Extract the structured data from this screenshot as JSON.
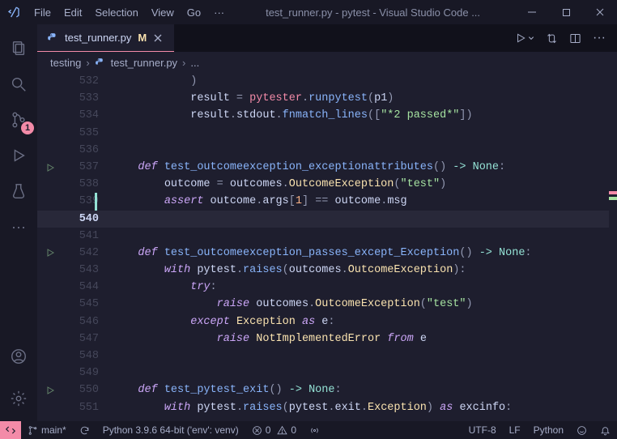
{
  "titlebar": {
    "menuItems": [
      "File",
      "Edit",
      "Selection",
      "View",
      "Go"
    ],
    "menuOverflow": "···",
    "title": "test_runner.py - pytest - Visual Studio Code ..."
  },
  "activitybar": {
    "sourceControlBadge": "1"
  },
  "tab": {
    "name": "test_runner.py",
    "modified": "M"
  },
  "breadcrumbs": {
    "folder": "testing",
    "file": "test_runner.py",
    "trail": "..."
  },
  "code": {
    "startLine": 532,
    "currentLine": 540,
    "editBarLine": 539,
    "runIconLines": [
      537,
      542,
      550
    ],
    "lines": [
      {
        "n": 532,
        "i": 2,
        "t": [
          {
            "c": "p",
            "v": ")"
          }
        ]
      },
      {
        "n": 533,
        "i": 2,
        "t": [
          {
            "c": "id",
            "v": "result"
          },
          {
            "c": "p",
            "v": " = "
          },
          {
            "c": "pr",
            "v": "pytester"
          },
          {
            "c": "p",
            "v": "."
          },
          {
            "c": "fn",
            "v": "runpytest"
          },
          {
            "c": "p",
            "v": "("
          },
          {
            "c": "id",
            "v": "p1"
          },
          {
            "c": "p",
            "v": ")"
          }
        ]
      },
      {
        "n": 534,
        "i": 2,
        "t": [
          {
            "c": "id",
            "v": "result"
          },
          {
            "c": "p",
            "v": "."
          },
          {
            "c": "id",
            "v": "stdout"
          },
          {
            "c": "p",
            "v": "."
          },
          {
            "c": "fn",
            "v": "fnmatch_lines"
          },
          {
            "c": "p",
            "v": "(["
          },
          {
            "c": "s",
            "v": "\"*2 passed*\""
          },
          {
            "c": "p",
            "v": "])"
          }
        ]
      },
      {
        "n": 535,
        "i": 0,
        "t": []
      },
      {
        "n": 536,
        "i": 0,
        "t": []
      },
      {
        "n": 537,
        "i": 0,
        "t": [
          {
            "c": "d",
            "v": "def"
          },
          {
            "c": "p",
            "v": " "
          },
          {
            "c": "fn",
            "v": "test_outcomeexception_exceptionattributes"
          },
          {
            "c": "p",
            "v": "()"
          },
          {
            "c": "p",
            "v": " "
          },
          {
            "c": "ar",
            "v": "->"
          },
          {
            "c": "p",
            "v": " "
          },
          {
            "c": "c",
            "v": "None"
          },
          {
            "c": "p",
            "v": ":"
          }
        ]
      },
      {
        "n": 538,
        "i": 1,
        "t": [
          {
            "c": "id",
            "v": "outcome"
          },
          {
            "c": "p",
            "v": " = "
          },
          {
            "c": "id",
            "v": "outcomes"
          },
          {
            "c": "p",
            "v": "."
          },
          {
            "c": "ty",
            "v": "OutcomeException"
          },
          {
            "c": "p",
            "v": "("
          },
          {
            "c": "s",
            "v": "\"test\""
          },
          {
            "c": "p",
            "v": ")"
          }
        ]
      },
      {
        "n": 539,
        "i": 1,
        "t": [
          {
            "c": "kw",
            "v": "assert"
          },
          {
            "c": "p",
            "v": " "
          },
          {
            "c": "id",
            "v": "outcome"
          },
          {
            "c": "p",
            "v": "."
          },
          {
            "c": "id",
            "v": "args"
          },
          {
            "c": "p",
            "v": "["
          },
          {
            "c": "n",
            "v": "1"
          },
          {
            "c": "p",
            "v": "]"
          },
          {
            "c": "p",
            "v": " == "
          },
          {
            "c": "id",
            "v": "outcome"
          },
          {
            "c": "p",
            "v": "."
          },
          {
            "c": "id",
            "v": "msg"
          }
        ]
      },
      {
        "n": 540,
        "i": 0,
        "t": []
      },
      {
        "n": 541,
        "i": 0,
        "t": []
      },
      {
        "n": 542,
        "i": 0,
        "t": [
          {
            "c": "d",
            "v": "def"
          },
          {
            "c": "p",
            "v": " "
          },
          {
            "c": "fn",
            "v": "test_outcomeexception_passes_except_Exception"
          },
          {
            "c": "p",
            "v": "()"
          },
          {
            "c": "p",
            "v": " "
          },
          {
            "c": "ar",
            "v": "->"
          },
          {
            "c": "p",
            "v": " "
          },
          {
            "c": "c",
            "v": "None"
          },
          {
            "c": "p",
            "v": ":"
          }
        ]
      },
      {
        "n": 543,
        "i": 1,
        "t": [
          {
            "c": "kw",
            "v": "with"
          },
          {
            "c": "p",
            "v": " "
          },
          {
            "c": "id",
            "v": "pytest"
          },
          {
            "c": "p",
            "v": "."
          },
          {
            "c": "fn",
            "v": "raises"
          },
          {
            "c": "p",
            "v": "("
          },
          {
            "c": "id",
            "v": "outcomes"
          },
          {
            "c": "p",
            "v": "."
          },
          {
            "c": "ty",
            "v": "OutcomeException"
          },
          {
            "c": "p",
            "v": "):"
          }
        ]
      },
      {
        "n": 544,
        "i": 2,
        "t": [
          {
            "c": "kw",
            "v": "try"
          },
          {
            "c": "p",
            "v": ":"
          }
        ]
      },
      {
        "n": 545,
        "i": 3,
        "t": [
          {
            "c": "kw",
            "v": "raise"
          },
          {
            "c": "p",
            "v": " "
          },
          {
            "c": "id",
            "v": "outcomes"
          },
          {
            "c": "p",
            "v": "."
          },
          {
            "c": "ty",
            "v": "OutcomeException"
          },
          {
            "c": "p",
            "v": "("
          },
          {
            "c": "s",
            "v": "\"test\""
          },
          {
            "c": "p",
            "v": ")"
          }
        ]
      },
      {
        "n": 546,
        "i": 2,
        "t": [
          {
            "c": "kw",
            "v": "except"
          },
          {
            "c": "p",
            "v": " "
          },
          {
            "c": "ty",
            "v": "Exception"
          },
          {
            "c": "p",
            "v": " "
          },
          {
            "c": "kw",
            "v": "as"
          },
          {
            "c": "p",
            "v": " "
          },
          {
            "c": "id",
            "v": "e"
          },
          {
            "c": "p",
            "v": ":"
          }
        ]
      },
      {
        "n": 547,
        "i": 3,
        "t": [
          {
            "c": "kw",
            "v": "raise"
          },
          {
            "c": "p",
            "v": " "
          },
          {
            "c": "ty",
            "v": "NotImplementedError"
          },
          {
            "c": "p",
            "v": " "
          },
          {
            "c": "kw",
            "v": "from"
          },
          {
            "c": "p",
            "v": " "
          },
          {
            "c": "id",
            "v": "e"
          }
        ]
      },
      {
        "n": 548,
        "i": 0,
        "t": []
      },
      {
        "n": 549,
        "i": 0,
        "t": []
      },
      {
        "n": 550,
        "i": 0,
        "t": [
          {
            "c": "d",
            "v": "def"
          },
          {
            "c": "p",
            "v": " "
          },
          {
            "c": "fn",
            "v": "test_pytest_exit"
          },
          {
            "c": "p",
            "v": "()"
          },
          {
            "c": "p",
            "v": " "
          },
          {
            "c": "ar",
            "v": "->"
          },
          {
            "c": "p",
            "v": " "
          },
          {
            "c": "c",
            "v": "None"
          },
          {
            "c": "p",
            "v": ":"
          }
        ]
      },
      {
        "n": 551,
        "i": 1,
        "t": [
          {
            "c": "kw",
            "v": "with"
          },
          {
            "c": "p",
            "v": " "
          },
          {
            "c": "id",
            "v": "pytest"
          },
          {
            "c": "p",
            "v": "."
          },
          {
            "c": "fn",
            "v": "raises"
          },
          {
            "c": "p",
            "v": "("
          },
          {
            "c": "id",
            "v": "pytest"
          },
          {
            "c": "p",
            "v": "."
          },
          {
            "c": "id",
            "v": "exit"
          },
          {
            "c": "p",
            "v": "."
          },
          {
            "c": "ty",
            "v": "Exception"
          },
          {
            "c": "p",
            "v": ")"
          },
          {
            "c": "p",
            "v": " "
          },
          {
            "c": "kw",
            "v": "as"
          },
          {
            "c": "p",
            "v": " "
          },
          {
            "c": "id",
            "v": "excinfo"
          },
          {
            "c": "p",
            "v": ":"
          }
        ]
      }
    ]
  },
  "statusbar": {
    "branch": "main*",
    "interpreter": "Python 3.9.6 64-bit ('env': venv)",
    "errors": "0",
    "warnings": "0",
    "encoding": "UTF-8",
    "eol": "LF",
    "language": "Python"
  },
  "minimap": {
    "marks": [
      {
        "topPct": 34,
        "color": "#f38ba8"
      },
      {
        "topPct": 35.5,
        "color": "#a6e3a1"
      }
    ]
  }
}
